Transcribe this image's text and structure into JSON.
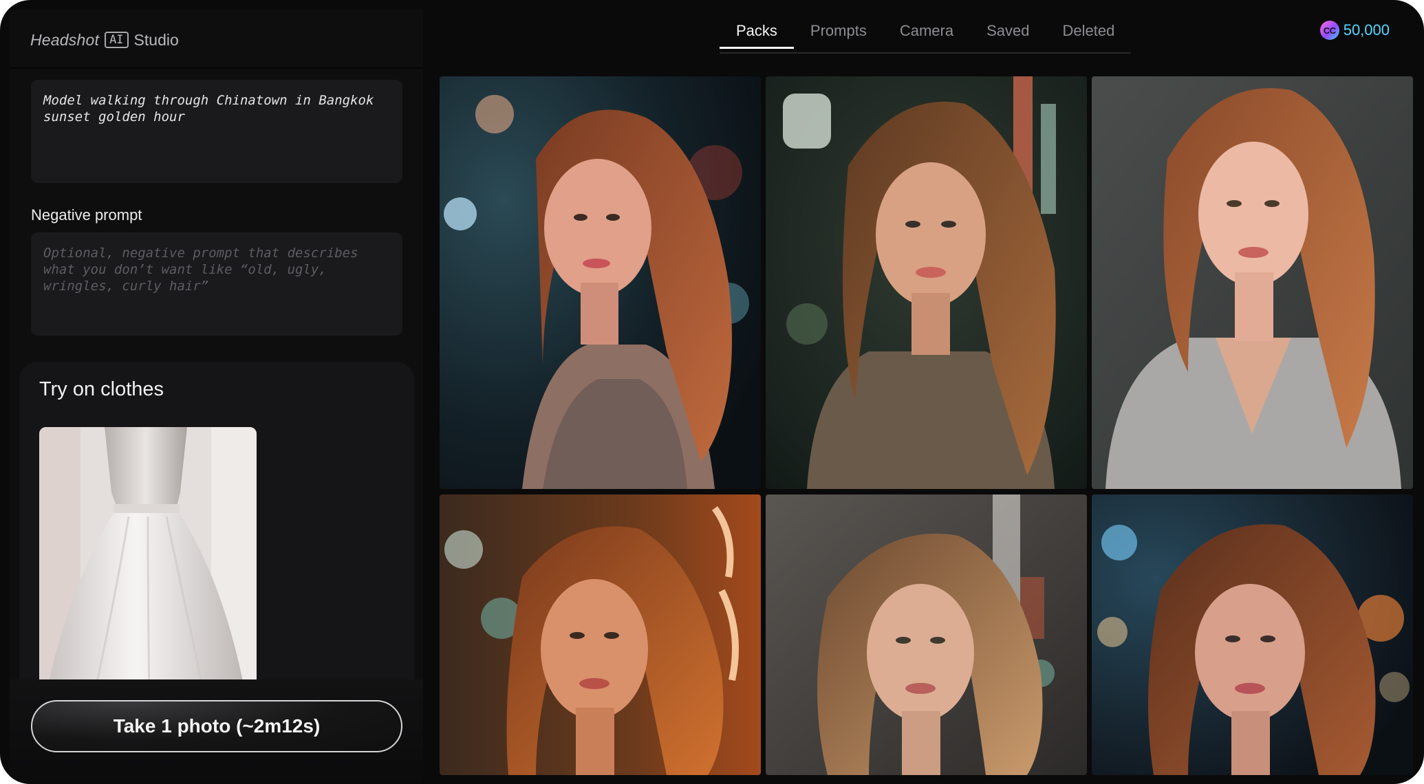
{
  "brand": {
    "name_prefix": "Headshot",
    "name_ai": "AI",
    "name_suffix": "Studio"
  },
  "prompt": {
    "value": "Model walking through Chinatown in Bangkok\nsunset golden hour"
  },
  "negative_prompt": {
    "label": "Negative prompt",
    "placeholder": "Optional, negative prompt that describes\nwhat you don’t want like “old, ugly,\nwringles, curly hair”"
  },
  "try_on": {
    "title": "Try on clothes",
    "garment_image": "white-tutu-dress"
  },
  "action": {
    "take_photo_label": "Take 1 photo (~2m12s)"
  },
  "tabs": [
    {
      "label": "Packs",
      "active": true
    },
    {
      "label": "Prompts",
      "active": false
    },
    {
      "label": "Camera",
      "active": false
    },
    {
      "label": "Saved",
      "active": false
    },
    {
      "label": "Deleted",
      "active": false
    }
  ],
  "credits": {
    "icon_text": "CC",
    "amount": "50,000",
    "color": "#55d7ff"
  },
  "gallery": {
    "photos": [
      {
        "id": "photo-1",
        "style": "night-neon-teal"
      },
      {
        "id": "photo-2",
        "style": "night-bokeh-green"
      },
      {
        "id": "photo-3",
        "style": "soft-daylight-grey-sweater"
      },
      {
        "id": "photo-4",
        "style": "neon-orange-glow"
      },
      {
        "id": "photo-5",
        "style": "city-street-backlit"
      },
      {
        "id": "photo-6",
        "style": "night-bokeh-blue-orange"
      }
    ]
  }
}
